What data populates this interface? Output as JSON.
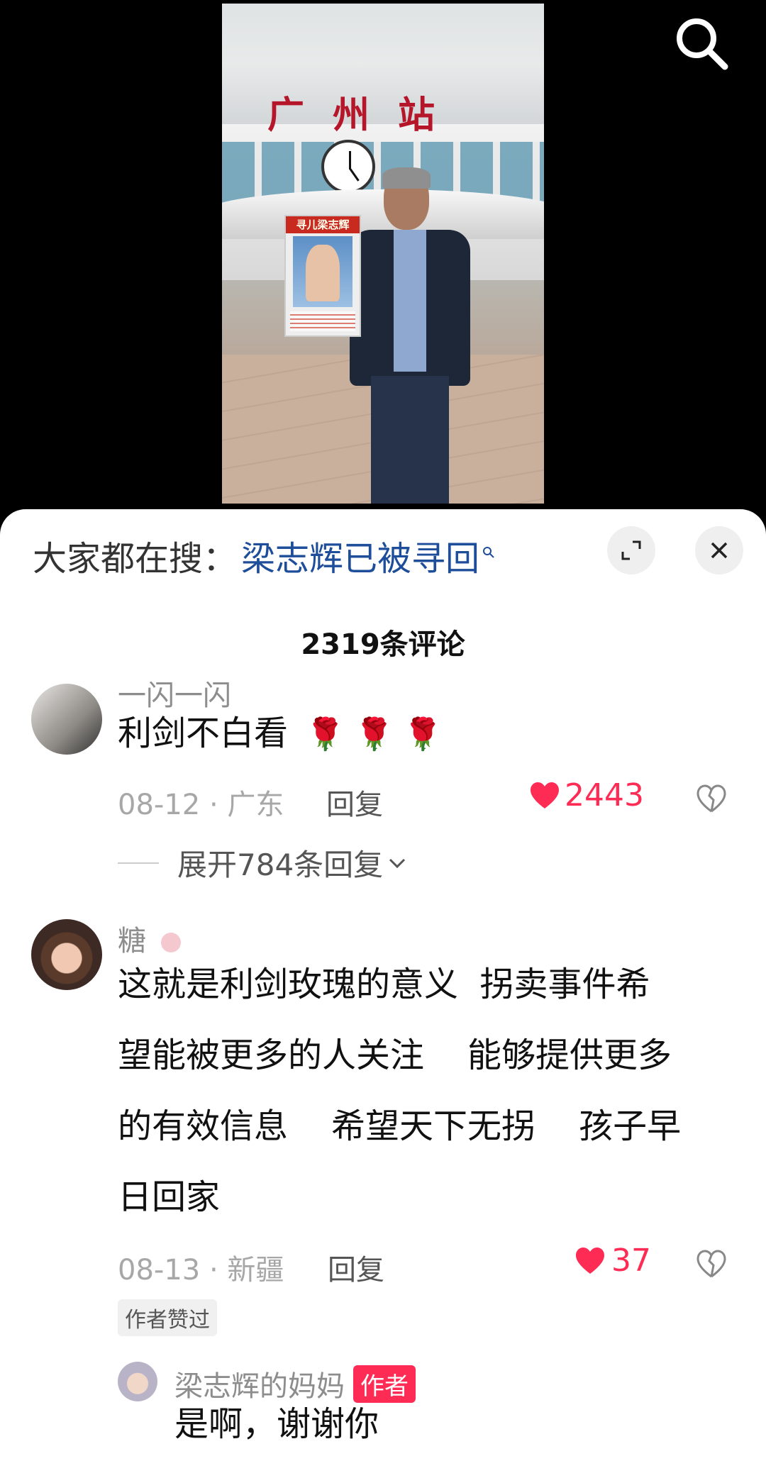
{
  "video": {
    "station_sign": "广州站",
    "poster_title": "寻儿梁志辉",
    "search_icon": "search-icon"
  },
  "hot_search": {
    "label": "大家都在搜：",
    "term": "梁志辉已被寻回"
  },
  "panel": {
    "comment_count": "2319条评论",
    "expand_icon": "expand-icon",
    "close_icon": "close-icon"
  },
  "comments": [
    {
      "username": "一闪一闪",
      "text": "利剑不白看",
      "emoji": "🌹 🌹 🌹",
      "date_location": "08-12 · 广东",
      "reply_label": "回复",
      "likes": "2443",
      "expand_label": "展开784条回复"
    },
    {
      "username": "糖",
      "text_lines": [
        "这就是利剑玫瑰的意义  拐卖事件希",
        "望能被更多的人关注    能够提供更多",
        "的有效信息    希望天下无拐    孩子早",
        "日回家"
      ],
      "date_location": "08-13 · 新疆",
      "reply_label": "回复",
      "likes": "37",
      "author_liked": "作者赞过",
      "reply": {
        "username": "梁志辉的妈妈",
        "author_tag": "作者",
        "text": "是啊，谢谢你"
      }
    }
  ],
  "colors": {
    "accent": "#fe2c55",
    "link": "#1e4d9a"
  }
}
